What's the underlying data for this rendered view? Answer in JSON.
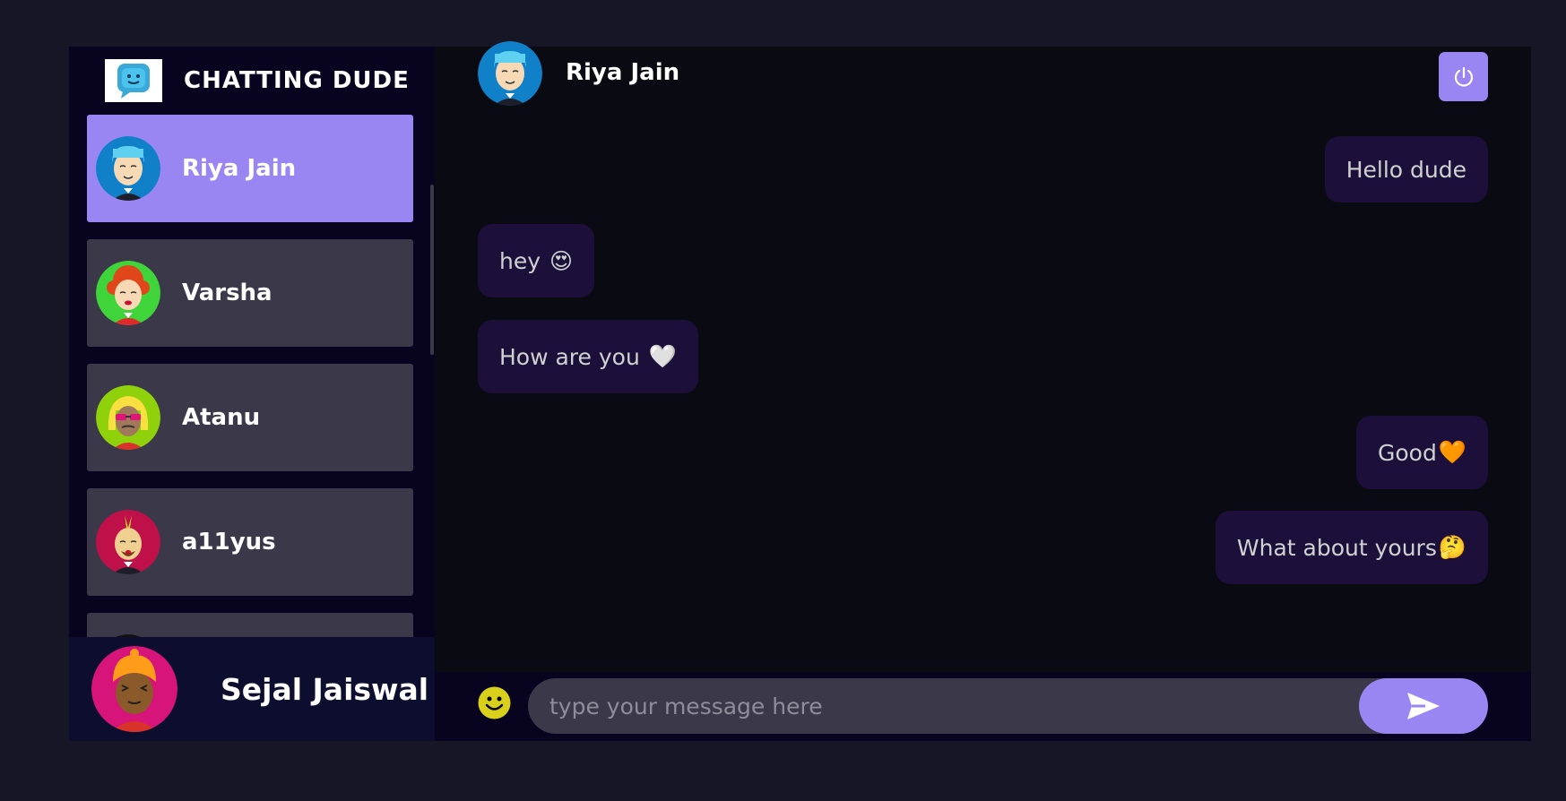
{
  "brand": {
    "title": "CHATTING DUDE",
    "logo_icon": "chat-bubble-face-icon"
  },
  "contacts": [
    {
      "name": "Riya Jain",
      "selected": true,
      "avatar": "avatar-blue-hair"
    },
    {
      "name": "Varsha",
      "selected": false,
      "avatar": "avatar-red-curly-hair"
    },
    {
      "name": "Atanu",
      "selected": false,
      "avatar": "avatar-blonde-sunglasses"
    },
    {
      "name": "a11yus",
      "selected": false,
      "avatar": "avatar-mohawk-beard"
    }
  ],
  "current_user": {
    "name": "Sejal Jaiswal",
    "avatar": "avatar-orange-turban"
  },
  "chat": {
    "contact_name": "Riya Jain",
    "messages": [
      {
        "text": "Hello dude",
        "emoji": "",
        "sent": true
      },
      {
        "text": "hey",
        "emoji": "😍",
        "sent": false
      },
      {
        "text": "How are you",
        "emoji": "🤍",
        "sent": false
      },
      {
        "text": "Good",
        "emoji": "🧡",
        "sent": true
      },
      {
        "text": "What about yours",
        "emoji": "🤔",
        "sent": true
      }
    ],
    "input": {
      "placeholder": "type your message here",
      "value": ""
    }
  },
  "colors": {
    "accent": "#9a86f3",
    "page_bg": "#161626",
    "sidebar_bg": "#080420",
    "contact_bg": "#3b3849",
    "bubble_bg": "#1c0f3a",
    "chat_bg": "#0a0a12"
  }
}
